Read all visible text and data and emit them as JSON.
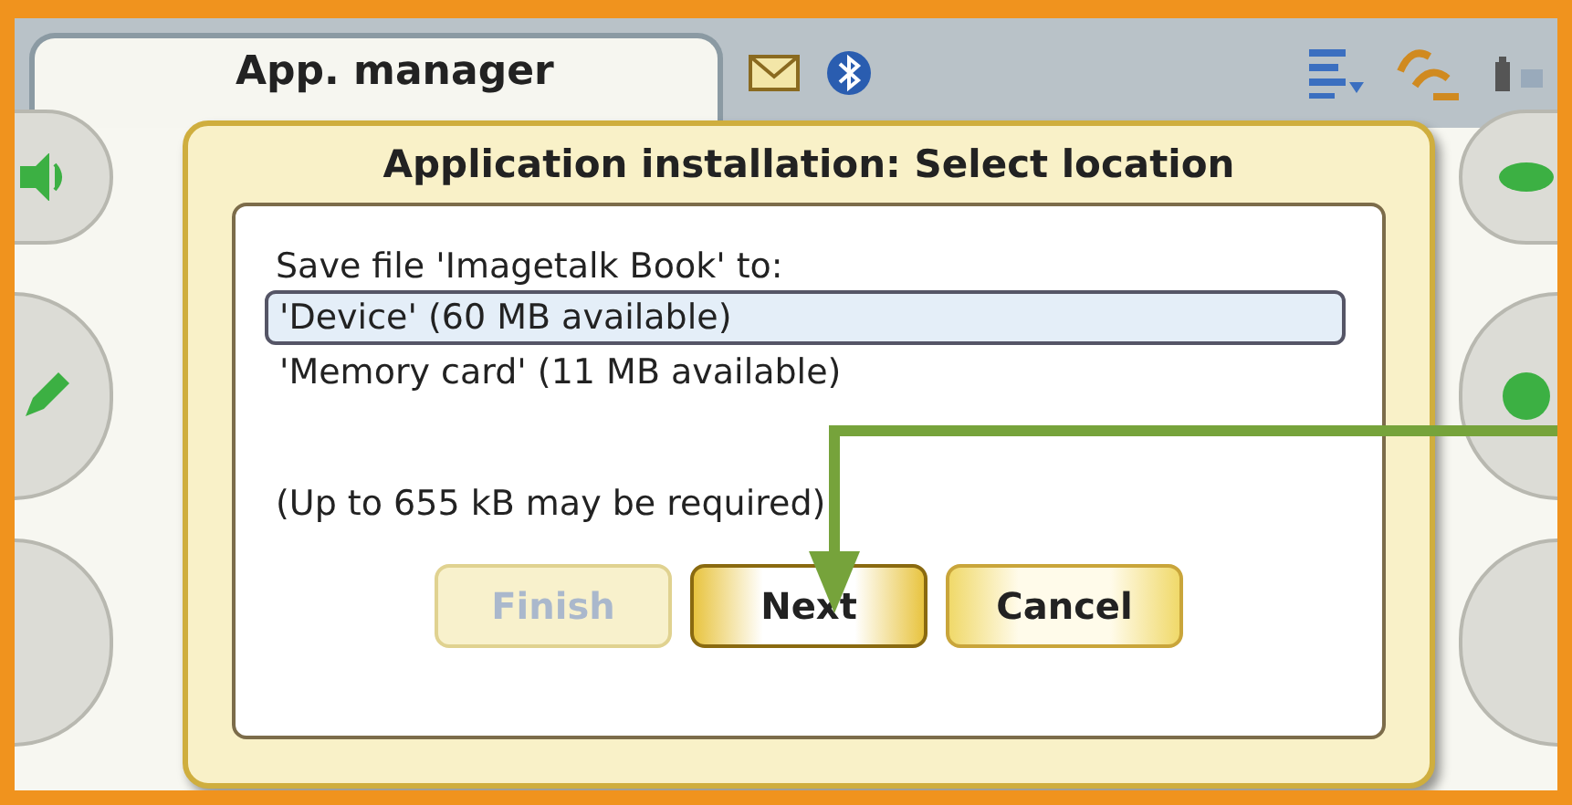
{
  "app_tab": {
    "title": "App. manager"
  },
  "dialog": {
    "title": "Application installation: Select location",
    "prompt": "Save file 'Imagetalk Book' to:",
    "options": [
      {
        "label": "'Device' (60 MB available)",
        "selected": true
      },
      {
        "label": "'Memory card' (11 MB available)",
        "selected": false
      }
    ],
    "note": "(Up to 655 kB may be required)",
    "buttons": [
      {
        "label": "Finish",
        "disabled": true,
        "selected": false
      },
      {
        "label": "Next",
        "disabled": false,
        "selected": true
      },
      {
        "label": "Cancel",
        "disabled": false,
        "selected": false
      }
    ]
  }
}
